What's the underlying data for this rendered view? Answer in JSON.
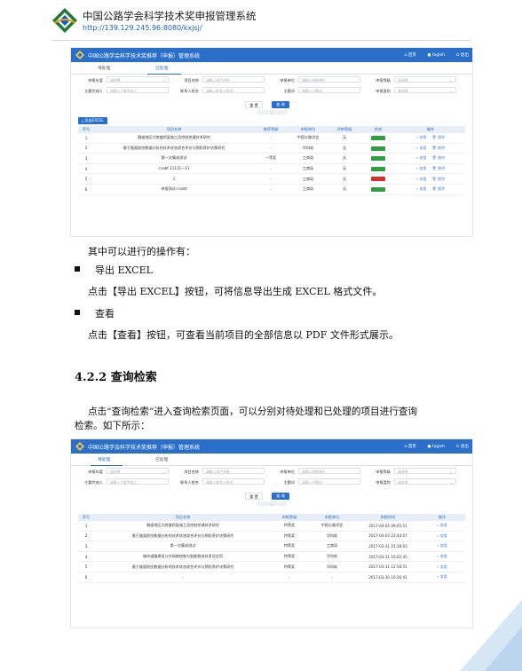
{
  "header": {
    "title": "中国公路学会科学技术奖申报管理系统",
    "url": "http://139.129.245.96:8080/kxjsj/"
  },
  "shot1": {
    "app_title": "中国公路学会科学技术奖推荐（申报）管理系统",
    "nav": [
      "首页",
      "fagleh",
      "退出"
    ],
    "tabs": [
      "待处理",
      "已处理"
    ],
    "active_tab": 1,
    "filters": [
      {
        "label": "申报年度",
        "placeholder": "请选择",
        "type": "select"
      },
      {
        "label": "项目名称",
        "placeholder": "请输入项目名称",
        "type": "text"
      },
      {
        "label": "申报单位",
        "placeholder": "请输入申报单位",
        "type": "text"
      },
      {
        "label": "申报等级",
        "placeholder": "请选择",
        "type": "select"
      },
      {
        "label": "主要完成人",
        "placeholder": "请输入主要完成人",
        "type": "text"
      },
      {
        "label": "联系人姓名",
        "placeholder": "请输入联系人姓名",
        "type": "text"
      },
      {
        "label": "主题词",
        "placeholder": "请输入主题词",
        "type": "text"
      },
      {
        "label": "申报类别",
        "placeholder": "请选择",
        "type": "select"
      }
    ],
    "reset_label": "重 置",
    "query_label": "查 询",
    "export_label": "导出EXCEL",
    "columns": [
      "序号",
      "项目名称",
      "推荐等级",
      "申报单位",
      "评审等级",
      "状态",
      "操作"
    ],
    "rows": [
      {
        "no": "1",
        "name": "隧道地区大跨度桥梁施工及控制关键技术研究",
        "grade": "-",
        "unit": "中国公路学会",
        "review": "无",
        "status_color": "#2e9e3e",
        "ops": [
          "查看",
          "删除"
        ]
      },
      {
        "no": "2",
        "name": "基于路面损伤数据分析的技术状态综合评价与预防养护决策研究",
        "grade": "-",
        "unit": "华科软",
        "review": "无",
        "status_color": "#2e9e3e",
        "ops": [
          "查看",
          "删除"
        ]
      },
      {
        "no": "3",
        "name": "第一次集成测试",
        "grade": "一等奖",
        "unit": "工商局",
        "review": "无",
        "status_color": "#2e9e3e",
        "ops": [
          "查看",
          "删除"
        ]
      },
      {
        "no": "4",
        "name": "cvxbt 11111一11",
        "grade": "-",
        "unit": "工商局",
        "review": "无",
        "status_color": "#2e9e3e",
        "ops": [
          "查看",
          "删除"
        ]
      },
      {
        "no": "5",
        "name": "1",
        "grade": "-",
        "unit": "工商局",
        "review": "无",
        "status_color": "#d9302c",
        "ops": [
          "查看",
          "删除"
        ]
      },
      {
        "no": "6",
        "name": "申报测试-cvxbt",
        "grade": "-",
        "unit": "工商局",
        "review": "无",
        "status_color": "#2e9e3e",
        "ops": [
          "查看",
          "删除"
        ]
      }
    ]
  },
  "body": {
    "intro": "其中可以进行的操作有：",
    "item1_title": "导出 EXCEL",
    "item1_text": "点击【导出 EXCEL】按钮，可将信息导出生成 EXCEL 格式文件。",
    "item2_title": "查看",
    "item2_text": "点击【查看】按钮，可查看当前项目的全部信息以 PDF 文件形式展示。",
    "section": "4.2.2 查询检索",
    "para_line1": "点击“查询检索”进入查询检索页面，可以分别对待处理和已处理的项目进行查询",
    "para_line2": "检索。如下所示："
  },
  "shot2": {
    "app_title": "中国公路学会科学技术奖推荐（申报）管理系统",
    "nav": [
      "首页",
      "fagleh",
      "退出"
    ],
    "tabs": [
      "待处理",
      "已处理"
    ],
    "active_tab": 0,
    "filters": [
      {
        "label": "申报年度",
        "placeholder": "请选择",
        "type": "select"
      },
      {
        "label": "项目名称",
        "placeholder": "请输入项目名称",
        "type": "text"
      },
      {
        "label": "申报单位",
        "placeholder": "请输入申报单位",
        "type": "text"
      },
      {
        "label": "申报等级",
        "placeholder": "请选择",
        "type": "select"
      },
      {
        "label": "主要完成人",
        "placeholder": "请输入主要完成人",
        "type": "text"
      },
      {
        "label": "联系人姓名",
        "placeholder": "请输入联系人姓名",
        "type": "text"
      },
      {
        "label": "主题词",
        "placeholder": "请输入主题词",
        "type": "text"
      },
      {
        "label": "申报类别",
        "placeholder": "请选择",
        "type": "select"
      }
    ],
    "reset_label": "重 置",
    "query_label": "查 询",
    "columns": [
      "序号",
      "项目名称",
      "申报等级",
      "申报单位",
      "申报时间",
      "操作"
    ],
    "rows": [
      {
        "no": "1",
        "name": "隧道地区大跨度桥梁施工及控制关键技术研究",
        "grade": "特等奖",
        "unit": "中国公路学会",
        "time": "2017-04-05 09:45:51",
        "op": "查看"
      },
      {
        "no": "2",
        "name": "基于路面损伤数据分析的技术状态综合评价与预防养护决策研究",
        "grade": "特等奖",
        "unit": "华科软",
        "time": "2017-04-03 23:44:07",
        "op": "查看"
      },
      {
        "no": "3",
        "name": "第一次集成测试",
        "grade": "特等奖",
        "unit": "工商局",
        "time": "2017-03-31 21:38:03",
        "op": "查看"
      },
      {
        "no": "4",
        "name": "城市道路建设公共网络控制与智能服务技术及应用",
        "grade": "特等奖",
        "unit": "华科软",
        "time": "2017-03-31 16:02:45",
        "op": "查看"
      },
      {
        "no": "5",
        "name": "基于路面损伤数据分析的技术状态综合评价与预防养护决策研究",
        "grade": "特等奖",
        "unit": "华科软",
        "time": "2017-03-31 12:58:51",
        "op": "查看"
      },
      {
        "no": "6",
        "name": "-",
        "grade": "-",
        "unit": "-",
        "time": "2017-03-30 16:36:41",
        "op": "查看"
      }
    ]
  },
  "colors": {
    "brand_blue": "#2a6fc9",
    "status_green": "#2e9e3e",
    "status_red": "#d9302c",
    "corner_blue": "#d6e6f5"
  }
}
